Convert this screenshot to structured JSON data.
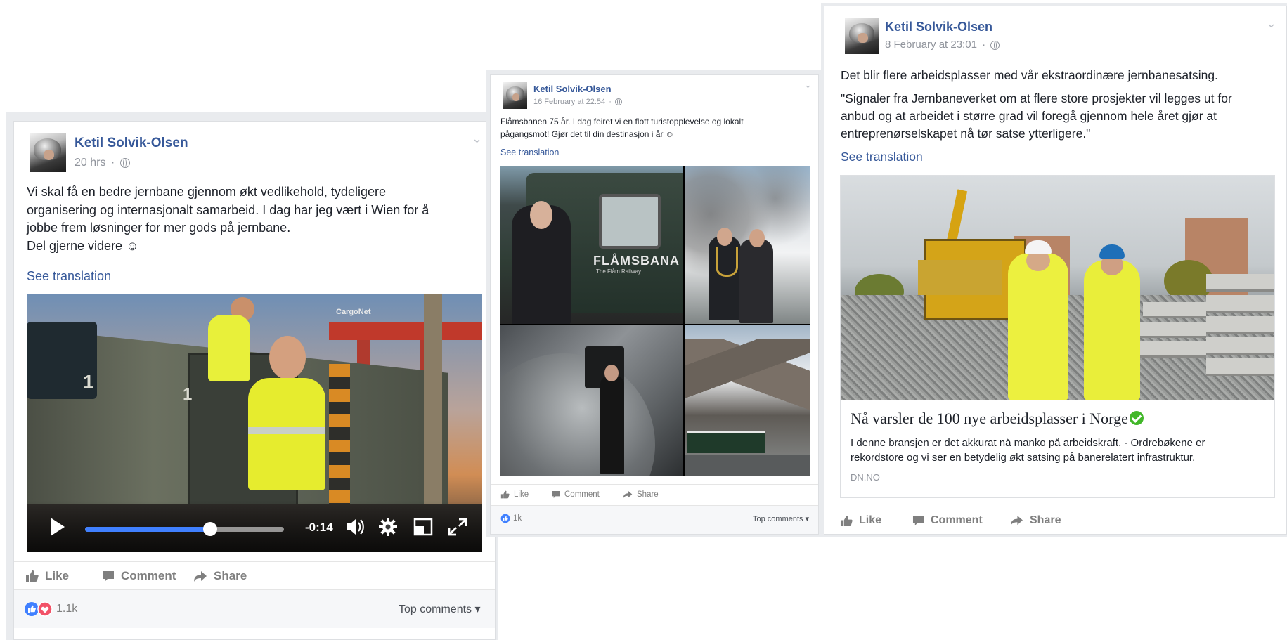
{
  "colors": {
    "link": "#365899",
    "meta": "#90949c",
    "action": "#7f7f7f",
    "like_blue": "#4080ff",
    "love_red": "#f25268",
    "verified_green": "#42b72a"
  },
  "post1": {
    "author": "Ketil Solvik-Olsen",
    "time": "20 hrs",
    "text_lines": [
      "Vi skal få en bedre jernbane gjennom økt vedlikehold, tydeligere",
      "organisering og internasjonalt samarbeid. I dag har jeg vært i Wien for å",
      "jobbe frem løsninger for mer gods på jernbane.",
      "Del gjerne videre ☺"
    ],
    "see_translation": "See translation",
    "video": {
      "time_remaining": "-0:14",
      "progress": 0.63,
      "watermark": "CargoNet",
      "car_number": "1"
    },
    "actions": {
      "like": "Like",
      "comment": "Comment",
      "share": "Share"
    },
    "reactions_count": "1.1k",
    "top_comments": "Top comments ▾"
  },
  "post2": {
    "author": "Ketil Solvik-Olsen",
    "time": "16 February at 22:54",
    "text_lines": [
      "Flåmsbanen 75 år. I dag feiret vi en flott turistopplevelse og lokalt",
      "pågangsmot! Gjør det til din destinasjon i år ☺"
    ],
    "see_translation": "See translation",
    "photo_logo": "FLÅMSBANA",
    "photo_logo_sub": "The Flåm Railway",
    "actions": {
      "like": "Like",
      "comment": "Comment",
      "share": "Share"
    },
    "reactions_count": "1k",
    "top_comments": "Top comments ▾"
  },
  "post3": {
    "author": "Ketil Solvik-Olsen",
    "time": "8 February at 23:01",
    "text_lines": [
      "Det blir flere arbeidsplasser med vår ekstraordinære jernbanesatsing."
    ],
    "quote_lines": [
      "\"Signaler fra Jernbaneverket om at flere store prosjekter vil legges ut for",
      "anbud og at arbeidet i større grad vil foregå gjennom hele året gjør at",
      "entreprenørselskapet nå tør satse ytterligere.\""
    ],
    "see_translation": "See translation",
    "link": {
      "title": "Nå varsler de 100 nye arbeidsplasser i Norge",
      "description_lines": [
        "I denne bransjen er det akkurat nå manko på arbeidskraft. - Ordrebøkene er",
        "rekordstore og vi ser en betydelig økt satsing på banerelatert infrastruktur."
      ],
      "domain": "DN.NO"
    },
    "actions": {
      "like": "Like",
      "comment": "Comment",
      "share": "Share"
    }
  }
}
